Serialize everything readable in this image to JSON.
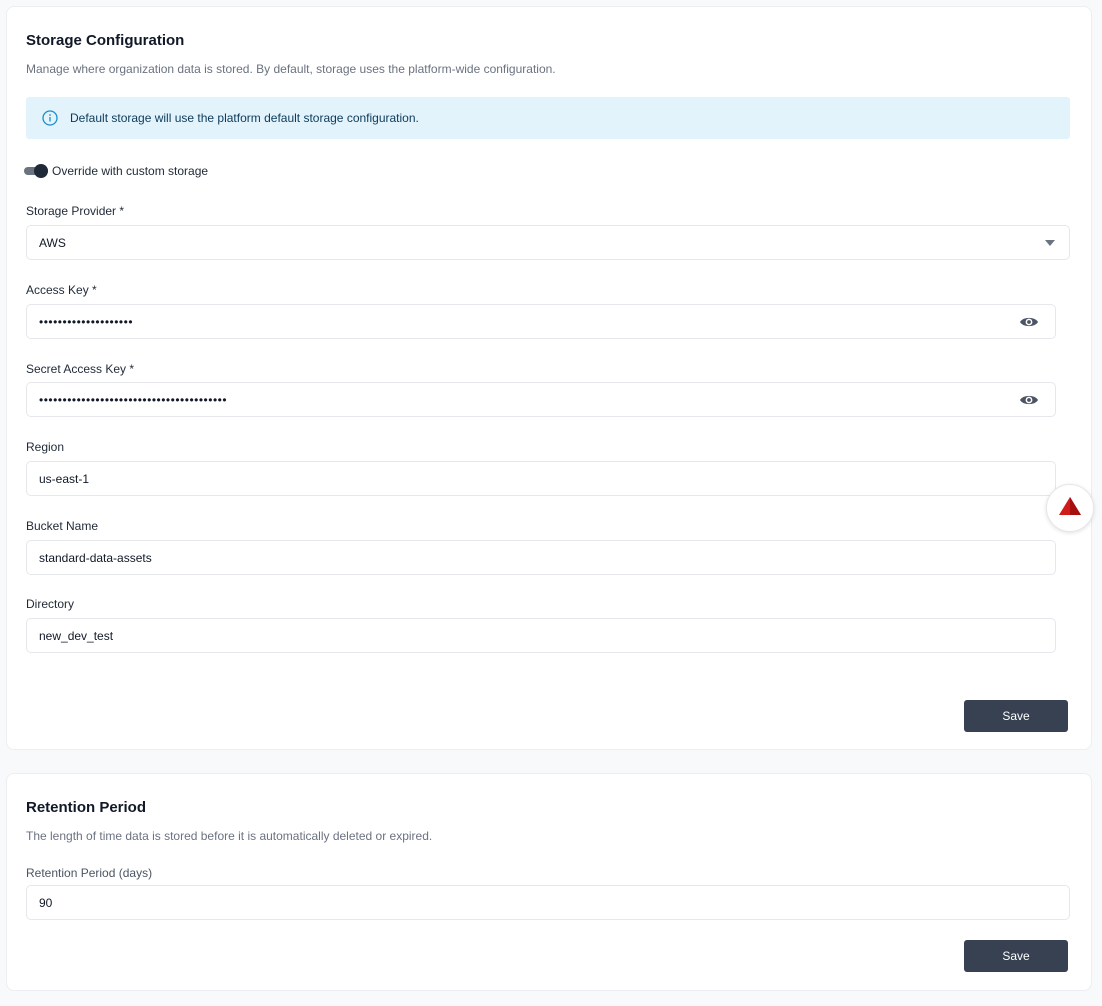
{
  "storage": {
    "title": "Storage Configuration",
    "description": "Manage where organization data is stored. By default, storage uses the platform-wide configuration.",
    "banner_text": "Default storage will use the platform default storage configuration.",
    "override_label": "Override with custom storage",
    "override_enabled": true,
    "provider": {
      "label": "Storage Provider *",
      "value": "AWS"
    },
    "access_key": {
      "label": "Access Key *",
      "masked_value": "••••••••••••••••••••"
    },
    "secret_access_key": {
      "label": "Secret Access Key *",
      "masked_value": "••••••••••••••••••••••••••••••••••••••••"
    },
    "region": {
      "label": "Region",
      "value": "us-east-1"
    },
    "bucket_name": {
      "label": "Bucket Name",
      "value": "standard-data-assets"
    },
    "directory": {
      "label": "Directory",
      "value": "new_dev_test"
    },
    "save_label": "Save"
  },
  "retention": {
    "title": "Retention Period",
    "description": "The length of time data is stored before it is automatically deleted or expired.",
    "field": {
      "label": "Retention Period (days)",
      "value": "90"
    },
    "save_label": "Save"
  },
  "icons": {
    "banner": "info-circle-icon",
    "reveal": "eye-icon",
    "caret": "caret-down-icon",
    "floating": "warning-triangle-icon"
  },
  "colors": {
    "banner_bg": "#e3f3fc",
    "banner_icon": "#1c8fc9",
    "button_bg": "#374151",
    "floating_icon": "#d11b1b"
  }
}
